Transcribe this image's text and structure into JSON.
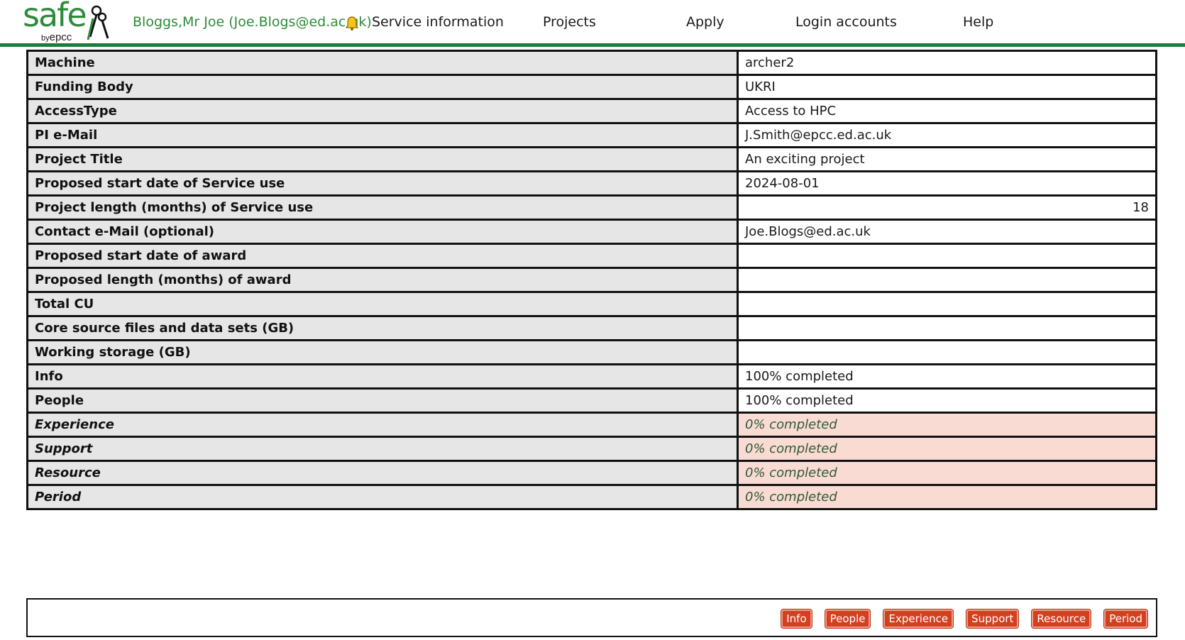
{
  "header": {
    "logo_text": "safe",
    "logo_by": "by",
    "logo_org": "epcc",
    "user": "Bloggs,Mr Joe (Joe.Blogs@ed.ac.uk)",
    "nav": [
      "Service information",
      "Projects",
      "Apply",
      "Login accounts",
      "Help"
    ],
    "accent_color": "#1f7a3a"
  },
  "details": [
    {
      "label": "Machine",
      "value": "archer2"
    },
    {
      "label": "Funding Body",
      "value": "UKRI"
    },
    {
      "label": "AccessType",
      "value": "Access to HPC"
    },
    {
      "label": "PI e-Mail",
      "value": "J.Smith@epcc.ed.ac.uk"
    },
    {
      "label": "Project Title",
      "value": "An exciting project"
    },
    {
      "label": "Proposed start date of Service use",
      "value": "2024-08-01"
    },
    {
      "label": "Project length (months) of Service use",
      "value": "18"
    },
    {
      "label": "Contact e-Mail (optional)",
      "value": "Joe.Blogs@ed.ac.uk"
    },
    {
      "label": "Proposed start date of award",
      "value": ""
    },
    {
      "label": "Proposed length (months) of award",
      "value": ""
    },
    {
      "label": "Total CU",
      "value": ""
    },
    {
      "label": "Core source files and data sets (GB)",
      "value": ""
    },
    {
      "label": "Working storage (GB)",
      "value": ""
    },
    {
      "label": "Info",
      "value": "100% completed"
    },
    {
      "label": "People",
      "value": "100% completed"
    },
    {
      "label": "Experience",
      "value": "0% completed"
    },
    {
      "label": "Support",
      "value": "0% completed"
    },
    {
      "label": "Resource",
      "value": "0% completed"
    },
    {
      "label": "Period",
      "value": "0% completed"
    }
  ],
  "section_buttons": [
    "Info",
    "People",
    "Experience",
    "Support",
    "Resource",
    "Period"
  ],
  "colors": {
    "incomplete_bg": "#fadbd3",
    "button_bg": "#d4401f",
    "label_bg": "#e6e6e6"
  }
}
